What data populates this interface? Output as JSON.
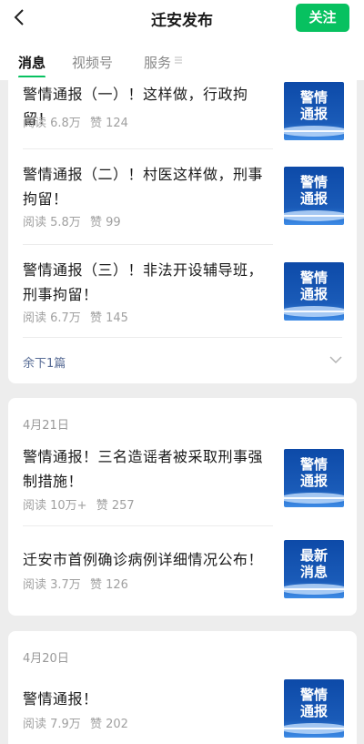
{
  "header": {
    "title": "迁安发布",
    "follow_label": "关注"
  },
  "tabs": [
    {
      "label": "消息"
    },
    {
      "label": "视频号"
    },
    {
      "label": "服务"
    }
  ],
  "groups": [
    {
      "date": "",
      "items": [
        {
          "title": "警情通报（一）！这样做，行政拘留！",
          "reads": "阅读 6.8万",
          "likes": "赞 124",
          "thumb": "警情\n通报"
        },
        {
          "title": "警情通报（二）！村医这样做，刑事拘留！",
          "reads": "阅读 5.8万",
          "likes": "赞 99",
          "thumb": "警情\n通报"
        },
        {
          "title": "警情通报（三）！非法开设辅导班，刑事拘留！",
          "reads": "阅读 6.7万",
          "likes": "赞 145",
          "thumb": "警情\n通报"
        }
      ],
      "remaining": "余下1篇"
    },
    {
      "date": "4月21日",
      "items": [
        {
          "title": "警情通报！三名造谣者被采取刑事强制措施！",
          "reads": "阅读 10万+",
          "likes": "赞 257",
          "thumb": "警情\n通报"
        },
        {
          "title": "迁安市首例确诊病例详细情况公布！",
          "reads": "阅读 3.7万",
          "likes": "赞 126",
          "thumb": "最新\n消息"
        }
      ]
    },
    {
      "date": "4月20日",
      "items": [
        {
          "title": "警情通报！",
          "reads": "阅读 7.9万",
          "likes": "赞 202",
          "thumb": "警情\n通报"
        }
      ]
    }
  ],
  "colors": {
    "accent": "#07c160",
    "link": "#576b95",
    "thumb_bg": "#1a5bb8"
  },
  "icons": [
    "back-arrow-icon",
    "menu-lines-icon",
    "chevron-down-icon"
  ]
}
